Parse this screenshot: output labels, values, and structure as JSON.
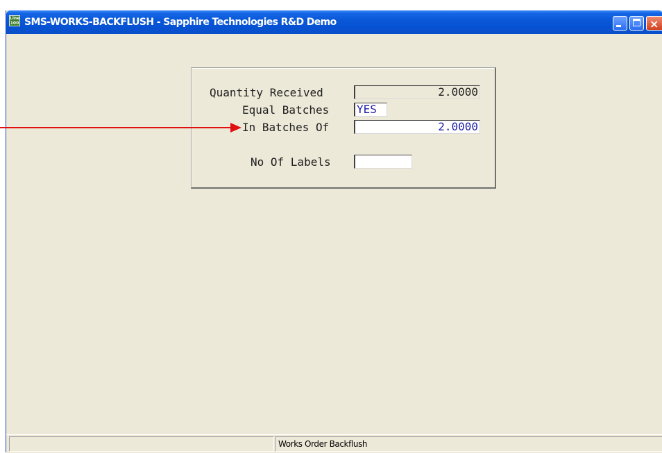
{
  "window": {
    "title": "SMS-WORKS-BACKFLUSH - Sapphire Technologies R&D Demo",
    "icon_text": "Line 100",
    "icon_name": "line-100-app-icon",
    "controls": [
      "minimize-icon",
      "maximize-icon",
      "close-icon"
    ]
  },
  "form": {
    "quantity_received": {
      "label": "Quantity Received",
      "value": "2.0000"
    },
    "equal_batches": {
      "label": "Equal Batches",
      "value": "YES"
    },
    "in_batches_of": {
      "label": "In Batches Of",
      "value": "2.0000"
    },
    "no_of_labels": {
      "label": "No Of Labels",
      "value": ""
    }
  },
  "status_bar": {
    "left": "",
    "right": "Works Order Backflush"
  },
  "annotation": {
    "color": "#e01010"
  },
  "colors": {
    "titlebar": "#0a58d8",
    "window_bg": "#ece9d8",
    "field_value": "#1f1fa8"
  }
}
